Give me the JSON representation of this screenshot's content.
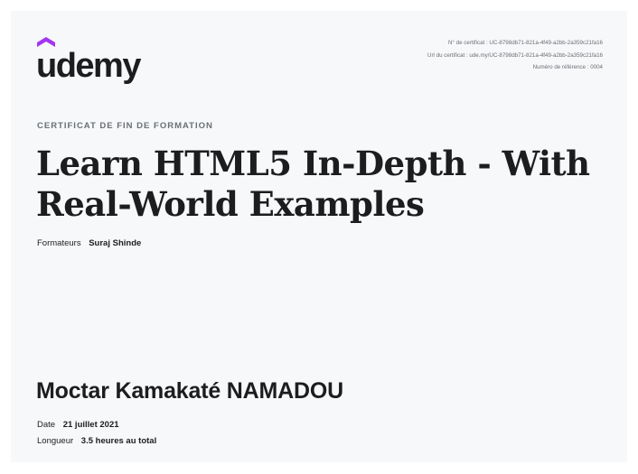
{
  "brand": {
    "logo_text": "udemy",
    "accent_color": "#a435f0"
  },
  "meta": {
    "certificate_no": "N° de certificat : UC-8798db71-821a-4f49-a2bb-2a359c21fa16",
    "certificate_url": "Url du certificat : ude.my/UC-8798db71-821a-4f49-a2bb-2a359c21fa16",
    "reference_no": "Numéro de référence : 0004"
  },
  "certificate": {
    "label": "CERTIFICAT DE FIN DE FORMATION",
    "course_title": "Learn HTML5 In-Depth - With Real-World Examples",
    "instructors_label": "Formateurs",
    "instructors_value": "Suraj Shinde",
    "recipient_name": "Moctar Kamakaté NAMADOU",
    "date_label": "Date",
    "date_value": "21 juillet 2021",
    "length_label": "Longueur",
    "length_value": "3.5 heures au total"
  }
}
